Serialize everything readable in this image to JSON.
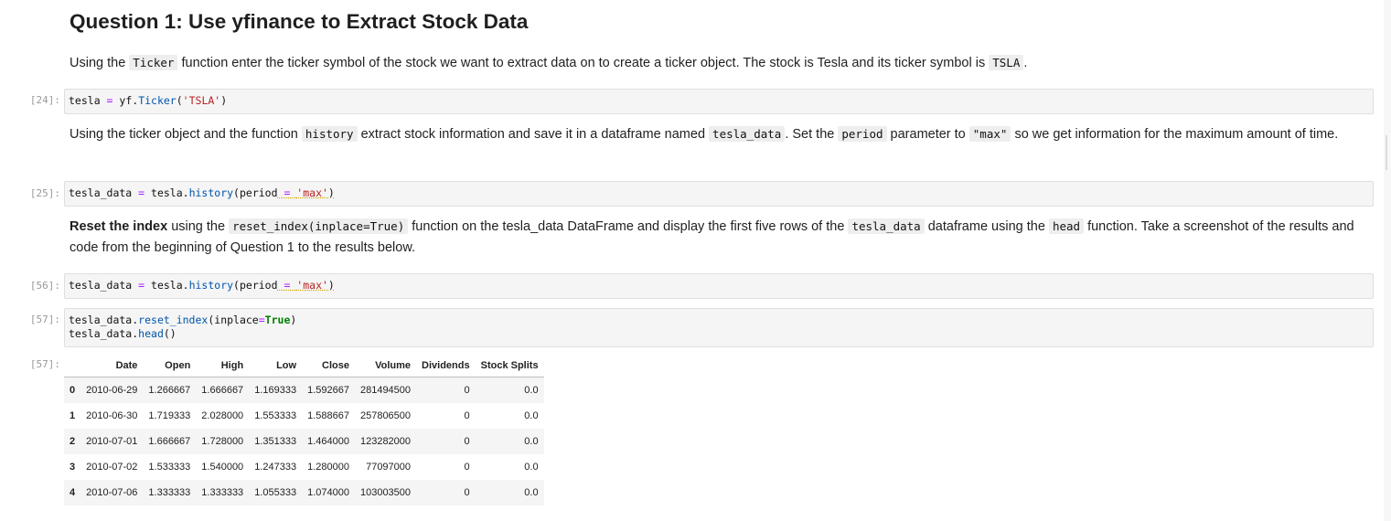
{
  "notebook": {
    "heading": "Question 1: Use yfinance to Extract Stock Data",
    "md1": {
      "t1": "Using the ",
      "c1": "Ticker",
      "t2": " function enter the ticker symbol of the stock we want to extract data on to create a ticker object. The stock is Tesla and its ticker symbol is ",
      "c2": "TSLA",
      "t3": "."
    },
    "cell24": {
      "prompt": "[24]:",
      "var": "tesla ",
      "op": "=",
      "obj": " yf.",
      "func": "Ticker",
      "open": "(",
      "arg": "'TSLA'",
      "close": ")"
    },
    "md2": {
      "t1": "Using the ticker object and the function ",
      "c1": "history",
      "t2": " extract stock information and save it in a dataframe named ",
      "c2": "tesla_data",
      "t3": ". Set the ",
      "c3": "period",
      "t4": " parameter to ",
      "c4": "\"max\"",
      "t5": " so we get information for the maximum amount of time."
    },
    "cell25": {
      "prompt": "[25]:",
      "var": "tesla_data ",
      "op": "=",
      "obj": " tesla.",
      "func": "history",
      "open": "(period",
      "eq": " = ",
      "arg": "'max'",
      "close": ")"
    },
    "md3": {
      "b1": "Reset the index",
      "t1": " using the ",
      "c1": "reset_index(inplace=True)",
      "t2": " function on the tesla_data DataFrame and display the first five rows of the ",
      "c2": "tesla_data",
      "t3": " dataframe using the ",
      "c3": "head",
      "t4": " function. Take a screenshot of the results and code from the beginning of Question 1 to the results below."
    },
    "cell56": {
      "prompt": "[56]:",
      "var": "tesla_data ",
      "op": "=",
      "obj": " tesla.",
      "func": "history",
      "open": "(period",
      "eq": " = ",
      "arg": "'max'",
      "close": ")"
    },
    "cell57": {
      "prompt": "[57]:",
      "l1_obj": "tesla_data.",
      "l1_func": "reset_index",
      "l1_open": "(inplace",
      "l1_op": "=",
      "l1_kw": "True",
      "l1_close": ")",
      "l2_obj": "tesla_data.",
      "l2_func": "head",
      "l2_paren": "()"
    },
    "output57": {
      "prompt": "[57]:",
      "columns": [
        "",
        "Date",
        "Open",
        "High",
        "Low",
        "Close",
        "Volume",
        "Dividends",
        "Stock Splits"
      ],
      "rows": [
        [
          "0",
          "2010-06-29",
          "1.266667",
          "1.666667",
          "1.169333",
          "1.592667",
          "281494500",
          "0",
          "0.0"
        ],
        [
          "1",
          "2010-06-30",
          "1.719333",
          "2.028000",
          "1.553333",
          "1.588667",
          "257806500",
          "0",
          "0.0"
        ],
        [
          "2",
          "2010-07-01",
          "1.666667",
          "1.728000",
          "1.351333",
          "1.464000",
          "123282000",
          "0",
          "0.0"
        ],
        [
          "3",
          "2010-07-02",
          "1.533333",
          "1.540000",
          "1.247333",
          "1.280000",
          "77097000",
          "0",
          "0.0"
        ],
        [
          "4",
          "2010-07-06",
          "1.333333",
          "1.333333",
          "1.055333",
          "1.074000",
          "103003500",
          "0",
          "0.0"
        ]
      ]
    }
  }
}
